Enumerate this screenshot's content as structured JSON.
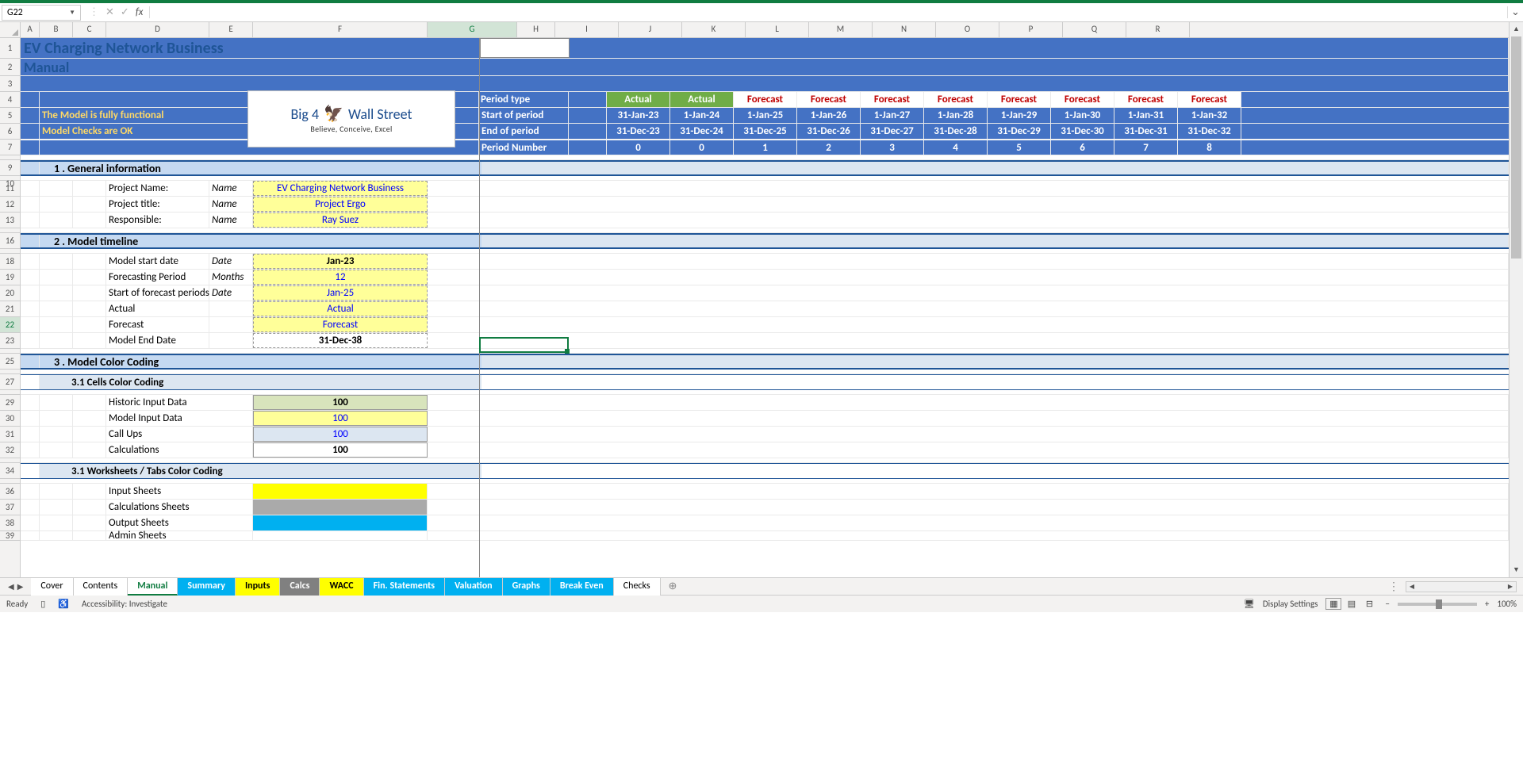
{
  "nameBox": "G22",
  "title": "EV Charging Network Business",
  "subtitle": "Manual",
  "status1": "The Model is fully functional",
  "status2": "Model Checks are OK",
  "logo": {
    "line1a": "Big 4",
    "line1b": "Wall Street",
    "line2": "Believe, Conceive, Excel"
  },
  "columns": [
    "A",
    "B",
    "C",
    "D",
    "E",
    "F",
    "G",
    "H",
    "I",
    "J",
    "K",
    "L",
    "M",
    "N",
    "O",
    "P",
    "Q",
    "R"
  ],
  "rowHeaders": [
    "1",
    "2",
    "3",
    "4",
    "5",
    "6",
    "7",
    "",
    "9",
    "10",
    "11",
    "12",
    "13",
    "",
    "16",
    "",
    "18",
    "19",
    "20",
    "21",
    "22",
    "23",
    "",
    "25",
    "",
    "27",
    "",
    "29",
    "30",
    "31",
    "32",
    "",
    "34",
    "",
    "36",
    "37",
    "38",
    "39"
  ],
  "periodLabels": {
    "type": "Period type",
    "start": "Start of period",
    "end": "End of period",
    "number": "Period Number"
  },
  "periods": [
    {
      "type": "Actual",
      "start": "31-Jan-23",
      "end": "31-Dec-23",
      "num": "0"
    },
    {
      "type": "Actual",
      "start": "1-Jan-24",
      "end": "31-Dec-24",
      "num": "0"
    },
    {
      "type": "Forecast",
      "start": "1-Jan-25",
      "end": "31-Dec-25",
      "num": "1"
    },
    {
      "type": "Forecast",
      "start": "1-Jan-26",
      "end": "31-Dec-26",
      "num": "2"
    },
    {
      "type": "Forecast",
      "start": "1-Jan-27",
      "end": "31-Dec-27",
      "num": "3"
    },
    {
      "type": "Forecast",
      "start": "1-Jan-28",
      "end": "31-Dec-28",
      "num": "4"
    },
    {
      "type": "Forecast",
      "start": "1-Jan-29",
      "end": "31-Dec-29",
      "num": "5"
    },
    {
      "type": "Forecast",
      "start": "1-Jan-30",
      "end": "31-Dec-30",
      "num": "6"
    },
    {
      "type": "Forecast",
      "start": "1-Jan-31",
      "end": "31-Dec-31",
      "num": "7"
    },
    {
      "type": "Forecast",
      "start": "1-Jan-32",
      "end": "31-Dec-32",
      "num": "8"
    }
  ],
  "sections": {
    "s1": "1 . General information",
    "s2": "2 . Model timeline",
    "s3": "3 . Model Color Coding",
    "s31": "3.1 Cells Color Coding",
    "s31b": "3.1 Worksheets / Tabs Color Coding"
  },
  "general": {
    "r1label": "Project Name:",
    "r1unit": "Name",
    "r1val": "EV Charging Network Business",
    "r2label": "Project title:",
    "r2unit": "Name",
    "r2val": "Project Ergo",
    "r3label": "Responsible:",
    "r3unit": "Name",
    "r3val": "Ray Suez"
  },
  "timeline": {
    "r1label": "Model start date",
    "r1unit": "Date",
    "r1val": "Jan-23",
    "r2label": "Forecasting Period",
    "r2unit": "Months",
    "r2val": "12",
    "r3label": "Start of forecast periods",
    "r3unit": "Date",
    "r3val": "Jan-25",
    "r4label": "Actual",
    "r4unit": "",
    "r4val": "Actual",
    "r5label": "Forecast",
    "r5unit": "",
    "r5val": "Forecast",
    "r6label": "Model End Date",
    "r6unit": "",
    "r6val": "31-Dec-38"
  },
  "coding": {
    "r1label": "Historic Input Data",
    "r1val": "100",
    "r2label": "Model Input Data",
    "r2val": "100",
    "r3label": "Call Ups",
    "r3val": "100",
    "r4label": "Calculations",
    "r4val": "100"
  },
  "tabsCoding": {
    "r1": "Input Sheets",
    "r2": "Calculations Sheets",
    "r3": "Output Sheets",
    "r4": "Admin Sheets"
  },
  "sheetTabs": [
    "Cover",
    "Contents",
    "Manual",
    "Summary",
    "Inputs",
    "Calcs",
    "WACC",
    "Fin. Statements",
    "Valuation",
    "Graphs",
    "Break Even",
    "Checks"
  ],
  "statusBar": {
    "ready": "Ready",
    "access": "Accessibility: Investigate",
    "display": "Display Settings",
    "zoom": "100%"
  }
}
